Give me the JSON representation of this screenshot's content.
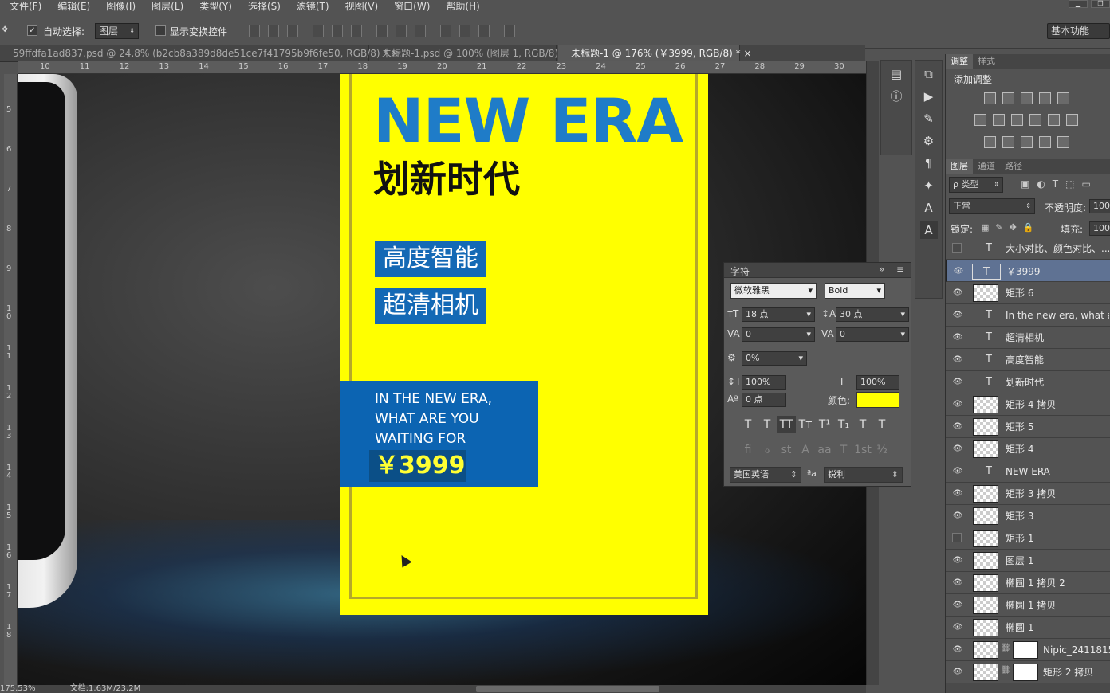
{
  "menu": [
    "文件(F)",
    "编辑(E)",
    "图像(I)",
    "图层(L)",
    "类型(Y)",
    "选择(S)",
    "滤镜(T)",
    "视图(V)",
    "窗口(W)",
    "帮助(H)"
  ],
  "options": {
    "auto_select_label": "自动选择:",
    "auto_select_value": "图层",
    "show_transform_label": "显示变换控件",
    "workspace": "基本功能"
  },
  "tabs": [
    {
      "label": "59ffdfa1ad837.psd @ 24.8% (b2cb8a389d8de51ce7f41795b9f6fe50, RGB/8) *"
    },
    {
      "label": "未标题-1.psd @ 100% (图层 1, RGB/8)"
    },
    {
      "label": "未标题-1 @ 176% (￥3999, RGB/8) *"
    }
  ],
  "ruler_top": [
    "10",
    "11",
    "12",
    "13",
    "14",
    "15",
    "16",
    "17",
    "18",
    "19",
    "20",
    "21",
    "22",
    "23",
    "24",
    "25",
    "26",
    "27",
    "28",
    "29",
    "30"
  ],
  "ruler_left": [
    "5",
    "6",
    "7",
    "8",
    "9",
    "1\n0",
    "1\n1",
    "1\n2",
    "1\n3",
    "1\n4",
    "1\n5",
    "1\n6",
    "1\n7",
    "1\n8"
  ],
  "poster": {
    "title_en": "NEW ERA",
    "title_cn": "划新时代",
    "tag1": "高度智能",
    "tag2": "超清相机",
    "eng_lines": [
      "IN THE NEW ERA,",
      "WHAT ARE YOU",
      "WAITING FOR"
    ],
    "price": "￥3999"
  },
  "status": {
    "zoom": "175.53%",
    "doc": "文档:1.63M/23.2M"
  },
  "char_panel": {
    "title": "字符",
    "font": "微软雅黑",
    "style": "Bold",
    "size": "18 点",
    "leading": "30 点",
    "kerning": "0",
    "tracking": "0",
    "tsume": "0%",
    "vscale": "100%",
    "hscale": "100%",
    "baseline": "0 点",
    "color_label": "颜色:",
    "text_buttons": [
      "T",
      "T",
      "TT",
      "Tт",
      "T¹",
      "T₁",
      "T",
      "T"
    ],
    "ot_buttons": [
      "fi",
      "ℴ",
      "st",
      "A",
      "aa",
      "T",
      "1st",
      "½"
    ],
    "language": "美国英语",
    "aa_label": "ªa",
    "aa_value": "锐利",
    "color": "#ffff00"
  },
  "right_panel": {
    "adj_tabs": [
      "调整",
      "样式"
    ],
    "add_adjust": "添加调整",
    "layer_tabs": [
      "图层",
      "通道",
      "路径"
    ],
    "filter": "ρ 类型",
    "blend": "正常",
    "opacity_label": "不透明度:",
    "opacity": "100%",
    "lock_label": "锁定:",
    "fill_label": "填充:",
    "fill": "100%"
  },
  "layers": [
    {
      "name": "大小对比、颜色对比、...",
      "type": "text",
      "visible": false,
      "selected": false
    },
    {
      "name": "￥3999",
      "type": "text",
      "visible": true,
      "selected": true
    },
    {
      "name": "矩形 6",
      "type": "shape",
      "visible": true,
      "selected": false
    },
    {
      "name": "In the new era, what are...",
      "type": "text",
      "visible": true,
      "selected": false
    },
    {
      "name": "超清相机",
      "type": "text",
      "visible": true,
      "selected": false
    },
    {
      "name": "高度智能",
      "type": "text",
      "visible": true,
      "selected": false
    },
    {
      "name": "划新时代",
      "type": "text",
      "visible": true,
      "selected": false
    },
    {
      "name": "矩形 4 拷贝",
      "type": "shape",
      "visible": true,
      "selected": false
    },
    {
      "name": "矩形 5",
      "type": "shape",
      "visible": true,
      "selected": false
    },
    {
      "name": "矩形 4",
      "type": "shape",
      "visible": true,
      "selected": false
    },
    {
      "name": "NEW ERA",
      "type": "text",
      "visible": true,
      "selected": false
    },
    {
      "name": "矩形 3 拷贝",
      "type": "shape",
      "visible": true,
      "selected": false
    },
    {
      "name": "矩形 3",
      "type": "shape",
      "visible": true,
      "selected": false
    },
    {
      "name": "矩形 1",
      "type": "shape",
      "visible": false,
      "selected": false
    },
    {
      "name": "图层 1",
      "type": "shape",
      "visible": true,
      "selected": false
    },
    {
      "name": "椭圆 1 拷贝 2",
      "type": "shape",
      "visible": true,
      "selected": false
    },
    {
      "name": "椭圆 1 拷贝",
      "type": "shape",
      "visible": true,
      "selected": false
    },
    {
      "name": "椭圆 1",
      "type": "shape",
      "visible": true,
      "selected": false
    },
    {
      "name": "Nipic_2411815...",
      "type": "masked",
      "visible": true,
      "selected": false
    },
    {
      "name": "矩形 2 拷贝",
      "type": "masked",
      "visible": true,
      "selected": false
    }
  ],
  "colors": {
    "accent_blue": "#1f7cc8",
    "poster_yellow": "#ffff00",
    "price_yellow": "#ffff33",
    "selected_layer": "#5f7293"
  }
}
